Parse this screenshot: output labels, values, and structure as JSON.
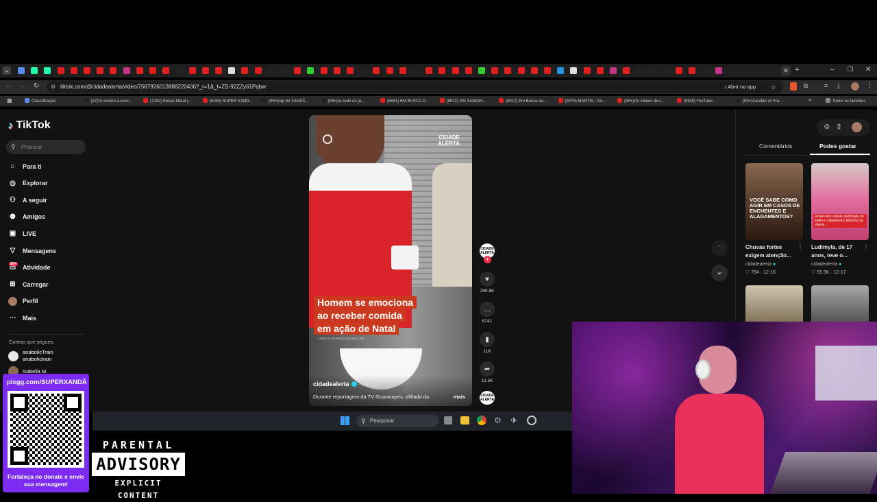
{
  "browser": {
    "url": "tiktok.com/@cidadealerta/video/7587926013888220436?_r=1&_t=ZS-92ZZy61Pqbw",
    "open_in_app": "Abrir no app",
    "bookmarks": [
      {
        "label": "Classificação",
        "color": "#5b8def"
      },
      {
        "label": "(97)Te ensino a venc...",
        "color": "#222"
      },
      {
        "label": "(7292) Enéas Metal |...",
        "color": "#e02020"
      },
      {
        "label": "(8159) SUPER XAND...",
        "color": "#e02020"
      },
      {
        "label": "(99+)rap do XANDÃ...",
        "color": "#222"
      },
      {
        "label": "(99+)tá cedo ou já...",
        "color": "#222"
      },
      {
        "label": "(8851) EM BUSCA D...",
        "color": "#e02020"
      },
      {
        "label": "(8912) VAI XANDIN...",
        "color": "#e02020"
      },
      {
        "label": "(8912) Em Busca da...",
        "color": "#e02020"
      },
      {
        "label": "(9078) MANTIS - XA...",
        "color": "#e02020"
      },
      {
        "label": "(99+)Os vídeos de c...",
        "color": "#e02020"
      },
      {
        "label": "(9338) YouTube",
        "color": "#e02020"
      },
      {
        "label": "(99+)Xandão vs Fra...",
        "color": "#222"
      }
    ],
    "all_favorites": "Todos os favoritos"
  },
  "tiktok": {
    "logo": "TikTok",
    "search_placeholder": "Procurar",
    "nav": [
      {
        "label": "Para ti",
        "icon": "home-icon"
      },
      {
        "label": "Explorar",
        "icon": "compass-icon"
      },
      {
        "label": "A seguir",
        "icon": "following-icon"
      },
      {
        "label": "Amigos",
        "icon": "friends-icon"
      },
      {
        "label": "LIVE",
        "icon": "live-icon"
      },
      {
        "label": "Mensagens",
        "icon": "messages-icon"
      },
      {
        "label": "Atividade",
        "icon": "activity-icon"
      },
      {
        "label": "Carregar",
        "icon": "upload-icon"
      },
      {
        "label": "Perfil",
        "icon": "profile-icon"
      },
      {
        "label": "Mais",
        "icon": "more-icon"
      }
    ],
    "activity_badge": "99+",
    "following_title": "Contas que segues",
    "following": [
      {
        "name": "anabolicTrain",
        "handle": "anabolictrain"
      },
      {
        "name": "Isabella M.",
        "handle": ""
      }
    ],
    "video": {
      "watermark": "CIDADE ALERTA",
      "caption_lines": [
        "Homem se emociona",
        "ao receber comida",
        "em ação de Natal"
      ],
      "credit": "CRÉDITO: REPRODUÇÃO/RECORD",
      "author": "cidadealerta",
      "time": "· Há 1 d",
      "description": "Durante reportagem da TV Guararapes, afiliada da",
      "more": "mais"
    },
    "actions": {
      "likes": "299.8K",
      "comments": "6741",
      "saves": "11K",
      "shares": "12.5K"
    },
    "right_tabs": {
      "comments": "Comentários",
      "suggested": "Podes gostar"
    },
    "cards": [
      {
        "thumb_text": "VOCÊ SABE COMO AGIR EM CASOS DE ENCHENTES E ALAGAMENTOS?",
        "title": "Chuvas fortes exigem atenção...",
        "author": "cidadealerta",
        "likes": "794",
        "date": "12-16"
      },
      {
        "thumb_text": "Jovem tem cabelo danificado no salão e cabeleireira debocha da cliente",
        "title": "Ludimyla, de 17 anos, teve o...",
        "author": "cidadealerta",
        "likes": "55.9K",
        "date": "12-17"
      }
    ]
  },
  "taskbar": {
    "search": "Pesquisar"
  },
  "overlay": {
    "pix_url": "pixgg.com/SUPERXANDÃ",
    "pix_text": "Fortaleça no donate e envie sua mensagem!",
    "advisory_top": "PARENTAL",
    "advisory_mid": "ADVISORY",
    "advisory_bottom": "EXPLICIT CONTENT"
  },
  "colors": {
    "tiktok_red": "#fe2c55",
    "pix_purple": "#7b2cf0",
    "caption_bg": "#c93a1e"
  }
}
